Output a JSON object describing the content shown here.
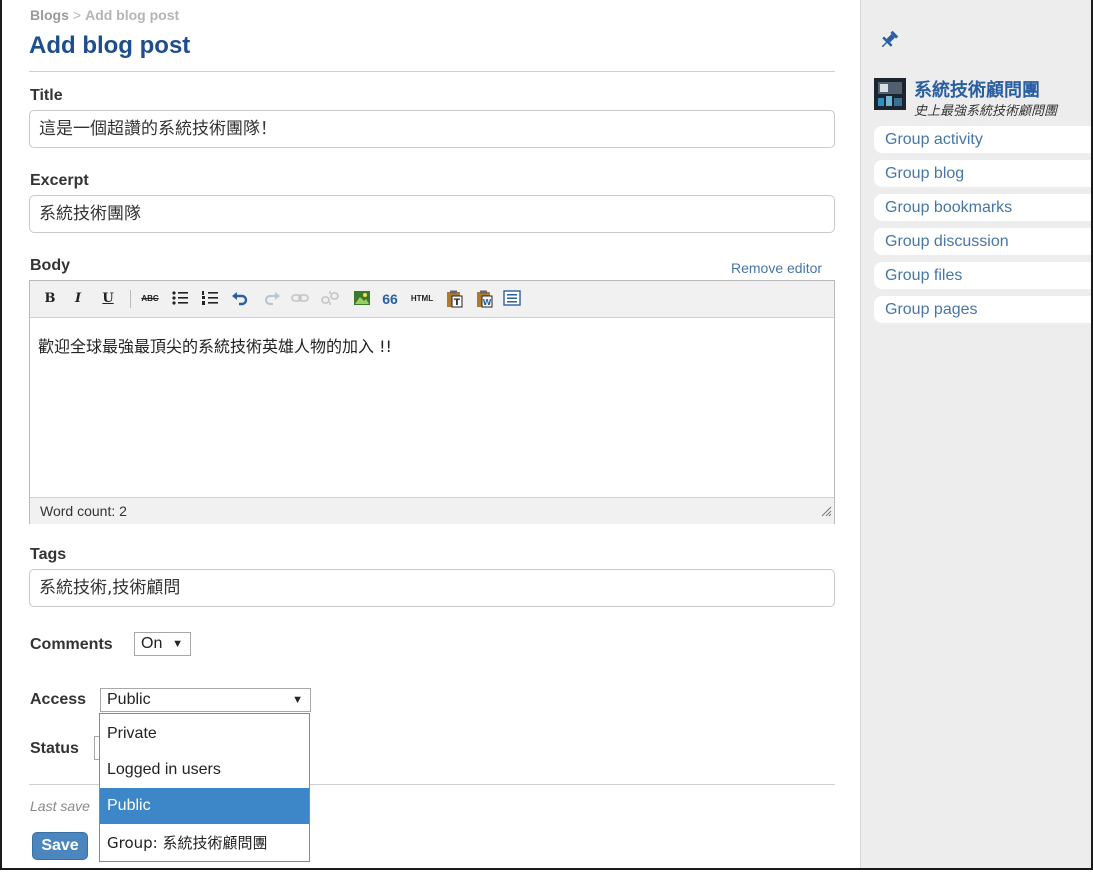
{
  "breadcrumb": {
    "root": "Blogs",
    "separator": ">",
    "current": "Add blog post"
  },
  "page_title": "Add blog post",
  "title_field": {
    "label": "Title",
    "value": "這是一個超讚的系統技術團隊！"
  },
  "excerpt_field": {
    "label": "Excerpt",
    "value": "系統技術團隊"
  },
  "body_field": {
    "label": "Body",
    "remove_editor_label": "Remove editor",
    "content": "歡迎全球最強最頂尖的系統技術英雄人物的加入 !!",
    "word_count": "Word count: 2",
    "toolbar": {
      "bold": "B",
      "italic": "I",
      "underline": "U",
      "strike": "ABC",
      "html": "HTML",
      "quote": "66",
      "icons": [
        "bold-icon",
        "italic-icon",
        "underline-icon",
        "strikethrough-icon",
        "bullet-list-icon",
        "numbered-list-icon",
        "undo-icon",
        "redo-icon",
        "link-icon",
        "unlink-icon",
        "image-icon",
        "blockquote-icon",
        "html-icon",
        "paste-text-icon",
        "paste-word-icon",
        "fullscreen-icon"
      ]
    }
  },
  "tags_field": {
    "label": "Tags",
    "value": "系統技術,技術顧問"
  },
  "comments_field": {
    "label": "Comments",
    "selected": "On",
    "arrow": "▼"
  },
  "access_field": {
    "label": "Access",
    "selected": "Public",
    "arrow": "▼",
    "options": [
      "Private",
      "Logged in users",
      "Public",
      "Group: 系統技術顧問團"
    ]
  },
  "status_field": {
    "label": "Status"
  },
  "last_saved": "Last save",
  "save_label": "Save",
  "sidebar": {
    "group_name": "系統技術顧問團",
    "group_subtitle": "史上最強系統技術顧問團",
    "items": [
      "Group activity",
      "Group blog",
      "Group bookmarks",
      "Group discussion",
      "Group files",
      "Group pages"
    ]
  },
  "colors": {
    "accent": "#1e4e8c",
    "link": "#4676a8",
    "selected": "#3d87c8",
    "sidebar_bg": "#ededed"
  }
}
